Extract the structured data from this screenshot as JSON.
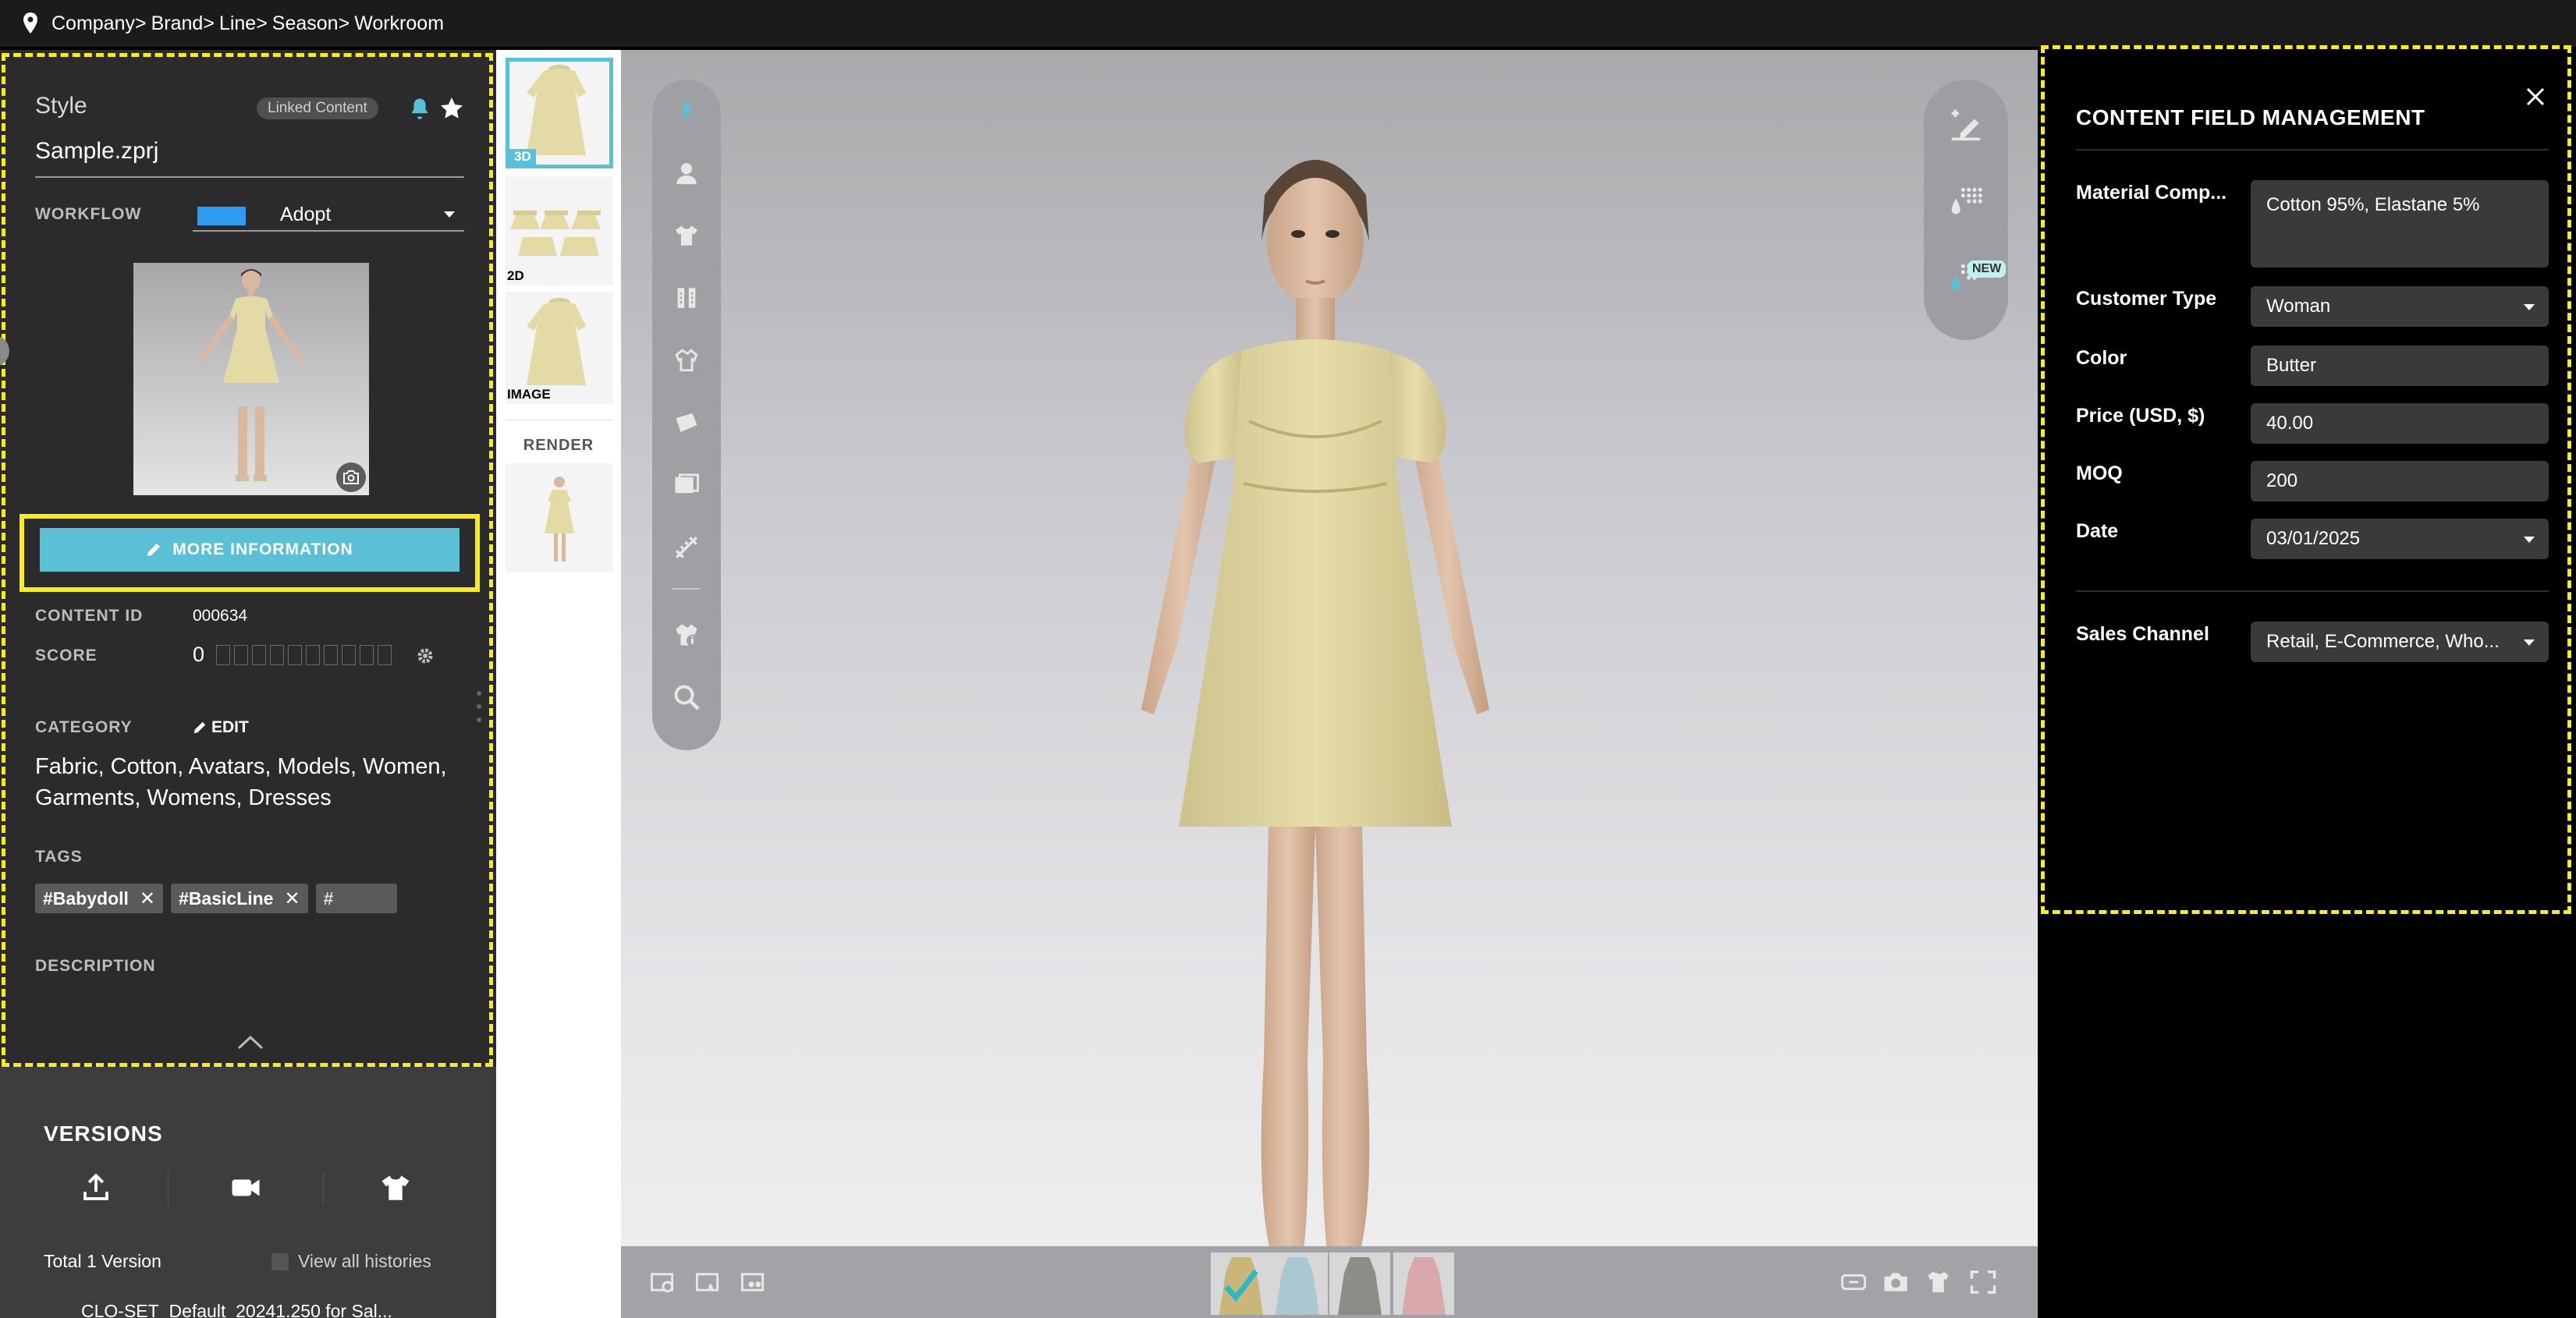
{
  "breadcrumb": [
    "Company>",
    "Brand>",
    "Line>",
    "Season>",
    "Workroom"
  ],
  "style_panel": {
    "header": "Style",
    "linked_badge": "Linked Content",
    "filename": "Sample.zprj",
    "workflow_label": "WORKFLOW",
    "workflow_value": "Adopt",
    "workflow_color": "#2f9bf0",
    "more_info_label": "MORE INFORMATION",
    "content_id_label": "CONTENT ID",
    "content_id": "000634",
    "score_label": "SCORE",
    "score": "0",
    "category_label": "CATEGORY",
    "category_edit": "EDIT",
    "category_text": "Fabric, Cotton, Avatars, Models, Women, Garments, Womens, Dresses",
    "tags_label": "TAGS",
    "tags": [
      "#Babydoll",
      "#BasicLine"
    ],
    "tag_placeholder": "#",
    "description_label": "DESCRIPTION"
  },
  "versions": {
    "title": "VERSIONS",
    "total": "Total 1 Version",
    "view_all": "View all histories",
    "row": "CLO-SET_Default_20241.250 for Sal..."
  },
  "strip": {
    "items": [
      "3D",
      "2D",
      "IMAGE"
    ],
    "render_label": "RENDER"
  },
  "right_tools": {
    "new_badge": "NEW"
  },
  "cfm": {
    "title": "CONTENT FIELD MANAGEMENT",
    "fields": [
      {
        "label": "Material Comp...",
        "value": "Cotton 95%, Elastane 5%",
        "type": "textarea"
      },
      {
        "label": "Customer Type",
        "value": "Woman",
        "type": "select"
      },
      {
        "label": "Color",
        "value": "Butter",
        "type": "text"
      },
      {
        "label": "Price (USD, $)",
        "value": "40.00",
        "type": "text"
      },
      {
        "label": "MOQ",
        "value": "200",
        "type": "text"
      },
      {
        "label": "Date",
        "value": "03/01/2025",
        "type": "select"
      },
      {
        "label": "Sales Channel",
        "value": "Retail, E-Commerce, Who...",
        "type": "select"
      }
    ]
  },
  "colors": {
    "accent": "#5bbfd6",
    "highlight": "#f7ea2c",
    "garment": "#e3daa6",
    "swatches": [
      "#c9b779",
      "#a9c8d2",
      "#8c8d86",
      "#d9a8ab"
    ]
  }
}
